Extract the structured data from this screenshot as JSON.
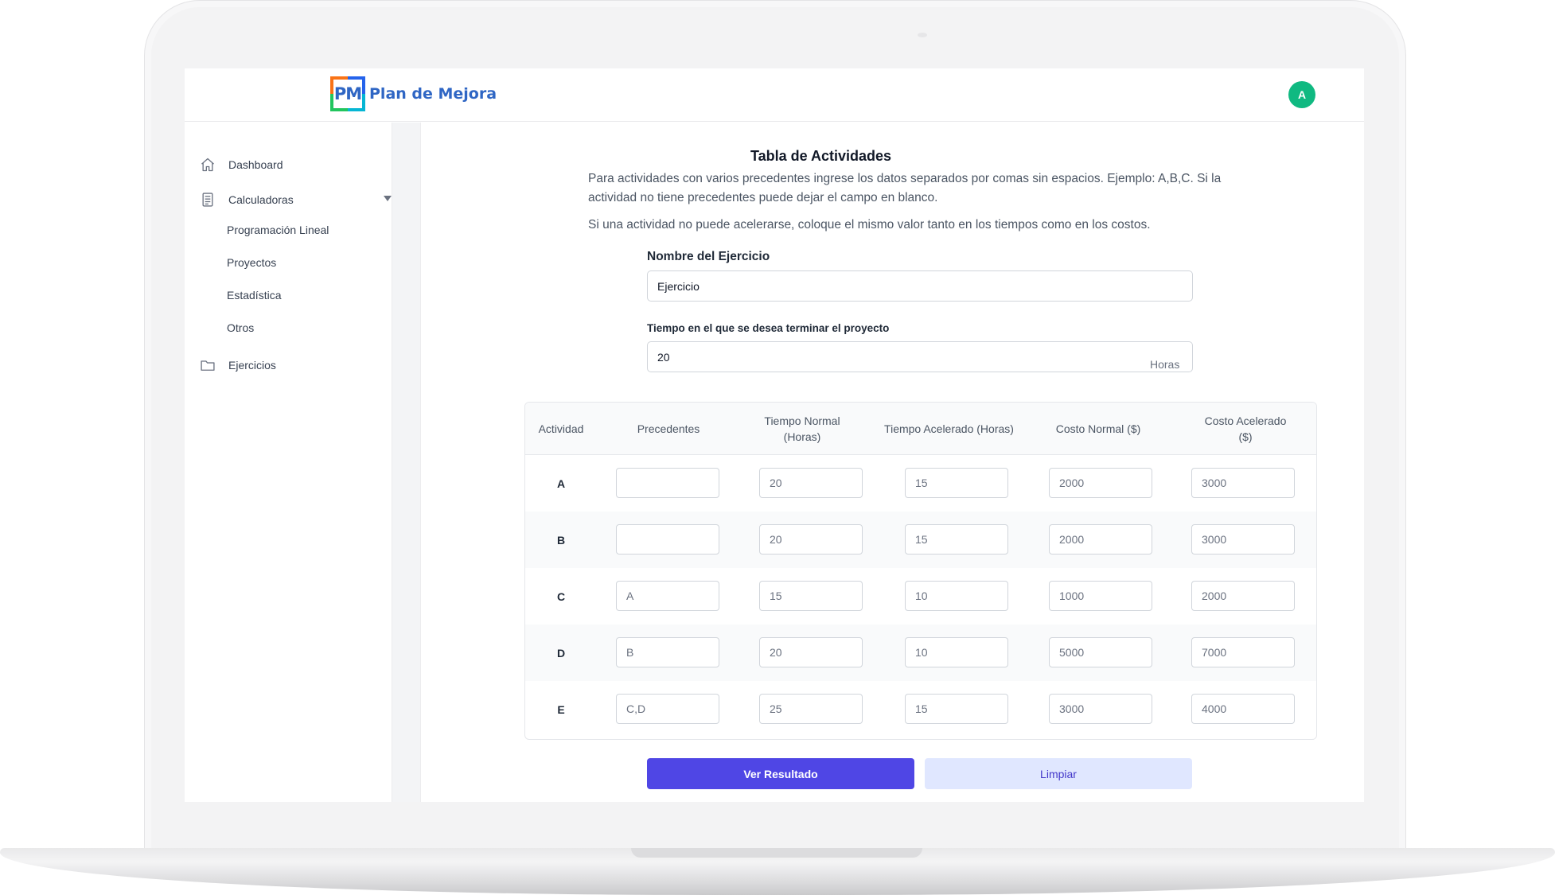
{
  "brand": {
    "logo_mark": "PM",
    "name": "Plan de Mejora",
    "colors": {
      "orange": "#f97316",
      "blue": "#2563eb",
      "green": "#22c55e",
      "cyan": "#06b6d4",
      "text": "#2f66c4"
    }
  },
  "user": {
    "initial": "A",
    "avatar_color": "#10b981"
  },
  "sidebar": {
    "items": [
      {
        "label": "Dashboard",
        "icon": "home-icon"
      },
      {
        "label": "Calculadoras",
        "icon": "calculator-icon",
        "expanded": true,
        "children": [
          "Programación Lineal",
          "Proyectos",
          "Estadística",
          "Otros"
        ]
      },
      {
        "label": "Ejercicios",
        "icon": "folder-icon"
      }
    ]
  },
  "main": {
    "title": "Tabla de Actividades",
    "instructions": [
      "Para actividades con varios precedentes ingrese los datos separados por comas sin espacios. Ejemplo: A,B,C. Si la actividad no tiene precedentes puede dejar el campo en blanco.",
      "Si una actividad no puede acelerarse, coloque el mismo valor tanto en los tiempos como en los costos."
    ],
    "exercise_name": {
      "label": "Nombre del Ejercicio",
      "value": "Ejercicio"
    },
    "target_time": {
      "label": "Tiempo en el que se desea terminar el proyecto",
      "value": "20",
      "suffix": "Horas"
    }
  },
  "table": {
    "headers": [
      "Actividad",
      "Precedentes",
      "Tiempo Normal (Horas)",
      "Tiempo Acelerado (Horas)",
      "Costo Normal ($)",
      "Costo Acelerado ($)"
    ],
    "rows": [
      {
        "actividad": "A",
        "precedentes": "",
        "tiempo_normal": "20",
        "tiempo_acelerado": "15",
        "costo_normal": "2000",
        "costo_acelerado": "3000"
      },
      {
        "actividad": "B",
        "precedentes": "",
        "tiempo_normal": "20",
        "tiempo_acelerado": "15",
        "costo_normal": "2000",
        "costo_acelerado": "3000"
      },
      {
        "actividad": "C",
        "precedentes": "A",
        "tiempo_normal": "15",
        "tiempo_acelerado": "10",
        "costo_normal": "1000",
        "costo_acelerado": "2000"
      },
      {
        "actividad": "D",
        "precedentes": "B",
        "tiempo_normal": "20",
        "tiempo_acelerado": "10",
        "costo_normal": "5000",
        "costo_acelerado": "7000"
      },
      {
        "actividad": "E",
        "precedentes": "C,D",
        "tiempo_normal": "25",
        "tiempo_acelerado": "15",
        "costo_normal": "3000",
        "costo_acelerado": "4000"
      }
    ]
  },
  "actions": {
    "primary_label": "Ver Resultado",
    "secondary_label": "Limpiar",
    "primary_color": "#4f46e5",
    "secondary_color": "#e0e7ff"
  }
}
